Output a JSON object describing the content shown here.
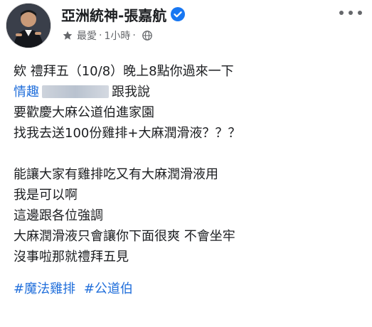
{
  "header": {
    "name": "亞洲統神-張嘉航",
    "audience": "最愛",
    "dot": "·",
    "time": "1小時",
    "icons": {
      "verified": "verified-badge-icon",
      "audience": "star-icon",
      "privacy": "globe-icon",
      "more": "more-options-icon"
    }
  },
  "post": {
    "line1": "欸 禮拜五（10/8）晚上8點你過來一下",
    "line2_link": "情趣",
    "line2_text": "跟我說",
    "line3": "要歡慶大麻公道伯進家園",
    "line4": "找我去送100份雞排+大麻潤滑液？？？",
    "line5": "能讓大家有雞排吃又有大麻潤滑液用",
    "line6": "我是可以啊",
    "line7": "這邊跟各位強調",
    "line8": "大麻潤滑液只會讓你下面很爽  不會坐牢",
    "line9": "沒事啦那就禮拜五見",
    "hashtags": [
      "#魔法雞排",
      "#公道伯"
    ]
  },
  "colors": {
    "link": "#216fdb",
    "verified": "#1877f2",
    "meta": "#65676b"
  }
}
